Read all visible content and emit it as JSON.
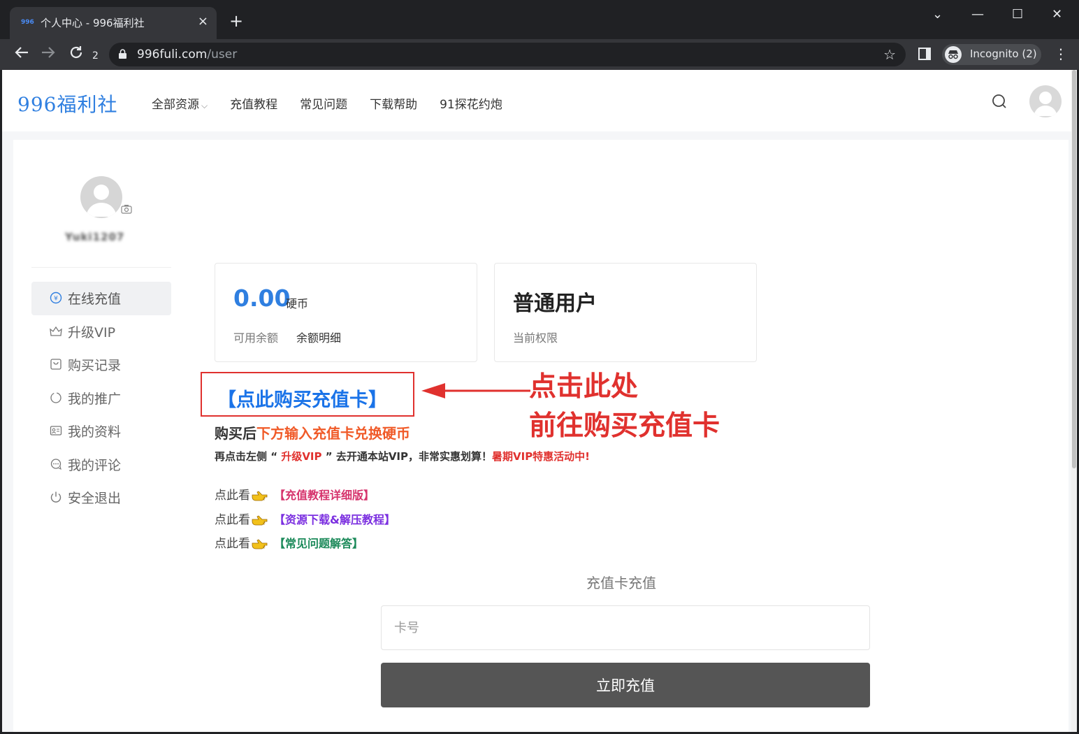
{
  "browser": {
    "tab_title": "个人中心 - 996福利社",
    "favicon_text": "996",
    "tab_close": "×",
    "new_tab": "+",
    "reload_badge": "2",
    "url_host": "996fuli.com",
    "url_path": "/user",
    "incognito_label": "Incognito (2)",
    "window_controls": {
      "chevron": "⌄",
      "minimize": "—",
      "maximize": "☐",
      "close": "✕"
    }
  },
  "site": {
    "logo": "996福利社",
    "nav": [
      {
        "label": "全部资源",
        "has_dropdown": true,
        "chevron": "⌵"
      },
      {
        "label": "充值教程"
      },
      {
        "label": "常见问题"
      },
      {
        "label": "下载帮助"
      },
      {
        "label": "91探花约炮"
      }
    ]
  },
  "user": {
    "name": "Yuki1207"
  },
  "sidebar": {
    "items": [
      {
        "label": "在线充值",
        "icon": "yen-circle-icon",
        "active": true
      },
      {
        "label": "升级VIP",
        "icon": "crown-icon"
      },
      {
        "label": "购买记录",
        "icon": "bag-icon"
      },
      {
        "label": "我的推广",
        "icon": "share-circle-icon"
      },
      {
        "label": "我的资料",
        "icon": "id-card-icon"
      },
      {
        "label": "我的评论",
        "icon": "comment-icon"
      },
      {
        "label": "安全退出",
        "icon": "power-icon"
      }
    ]
  },
  "cards": {
    "balance": "0.00",
    "balance_unit": "硬币",
    "balance_label": "可用余额",
    "balance_detail_link": "余额明细",
    "role": "普通用户",
    "role_label": "当前权限"
  },
  "promo": {
    "buy_card_link": "【点此购买充值卡】",
    "callout_line1": "点击此处",
    "callout_line2": "前往购买充值卡",
    "after_buy_prefix": "购买后",
    "after_buy_suffix": "下方输入充值卡兑换硬币",
    "vip_text_1": "再点击左侧 “",
    "vip_text_link": " 升级VIP ",
    "vip_text_2": "” 去开通本站VIP，非常实惠划算！",
    "vip_text_promo": "暑期VIP特惠活动中!",
    "help_prefix": "点此看",
    "help_links": [
      {
        "label": "【充值教程详细版】",
        "color": "#d6336c"
      },
      {
        "label": "【资源下载&解压教程】",
        "color": "#7b2fe0"
      },
      {
        "label": "【常见问题解答】",
        "color": "#1c8a5a"
      }
    ]
  },
  "recharge": {
    "title": "充值卡充值",
    "input_placeholder": "卡号",
    "submit_label": "立即充值"
  },
  "colors": {
    "brand_blue": "#2f7fe0",
    "annotation_red": "#e0312e",
    "orange": "#f05a28",
    "button_gray": "#555555"
  }
}
